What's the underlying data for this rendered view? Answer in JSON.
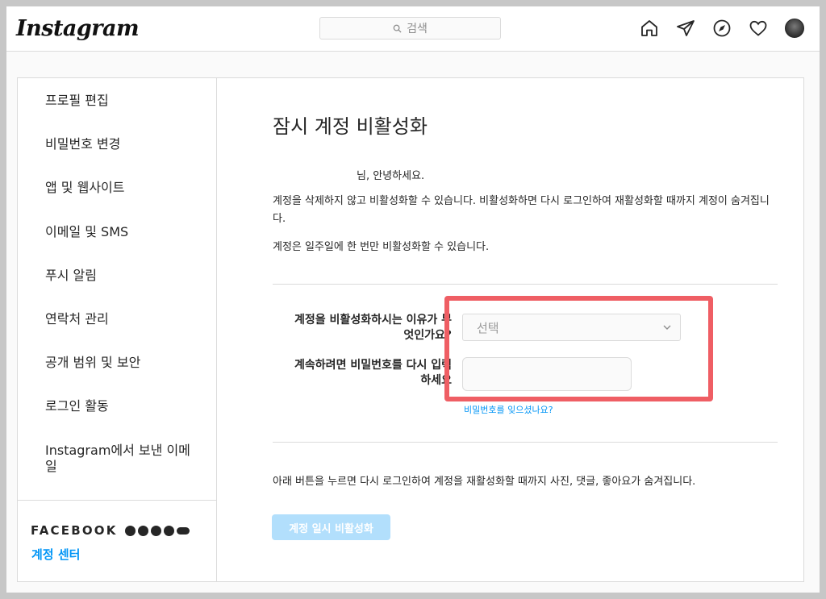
{
  "header": {
    "logo": "Instagram",
    "search_placeholder": "검색",
    "icons": [
      "home-icon",
      "direct-icon",
      "explore-icon",
      "activity-heart-icon",
      "profile-avatar"
    ]
  },
  "sidebar": {
    "items": [
      {
        "label": "프로필 편집"
      },
      {
        "label": "비밀번호 변경"
      },
      {
        "label": "앱 및 웹사이트"
      },
      {
        "label": "이메일 및 SMS"
      },
      {
        "label": "푸시 알림"
      },
      {
        "label": "연락처 관리"
      },
      {
        "label": "공개 범위 및 보안"
      },
      {
        "label": "로그인 활동"
      },
      {
        "label": "Instagram에서 보낸 이메일"
      }
    ],
    "facebook_label": "FACEBOOK",
    "accounts_center": "계정 센터"
  },
  "main": {
    "title": "잠시 계정 비활성화",
    "greeting_suffix": "님, 안녕하세요.",
    "paragraph1": "계정을 삭제하지 않고 비활성화할 수 있습니다. 비활성화하면 다시 로그인하여 재활성화할 때까지 계정이 숨겨집니다.",
    "paragraph2": "계정은 일주일에 한 번만 비활성화할 수 있습니다.",
    "reason_label": "계정을 비활성화하시는 이유가 무엇인가요?",
    "reason_select_value": "선택",
    "password_label": "계속하려면 비밀번호를 다시 입력하세요",
    "password_value": "",
    "forgot_password": "비밀번호를 잊으셨나요?",
    "bottom_note": "아래 버튼을 누르면 다시 로그인하여 계정을 재활성화할 때까지 사진, 댓글, 좋아요가 숨겨집니다.",
    "deactivate_button": "계정 일시 비활성화"
  },
  "colors": {
    "accent": "#0095f6",
    "button_disabled": "#b2dffc",
    "highlight": "#ef5e64",
    "border": "#dbdbdb"
  }
}
